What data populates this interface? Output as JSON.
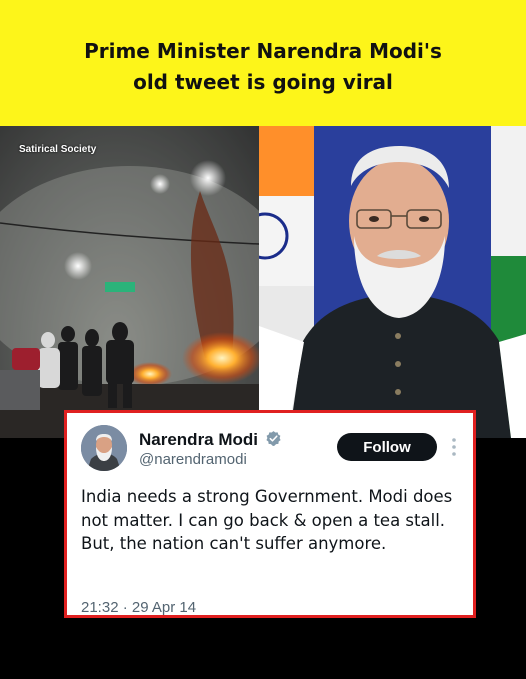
{
  "banner": {
    "headline_line1": "Prime Minister Narendra Modi's",
    "headline_line2": "old tweet is going viral",
    "background": "#fdf51a"
  },
  "left_photo": {
    "watermark": "Satirical Society"
  },
  "tweet": {
    "author_name": "Narendra Modi",
    "handle": "@narendramodi",
    "verified": true,
    "follow_label": "Follow",
    "text": "India needs a strong Government. Modi does not matter. I can go back & open a tea stall. But, the nation can't suffer anymore.",
    "timestamp": "21:32 · 29 Apr 14",
    "border_color": "#e02020",
    "verified_color": "#829aab"
  },
  "icons": {
    "verified": "verified-badge-icon",
    "more": "more-options-icon"
  }
}
